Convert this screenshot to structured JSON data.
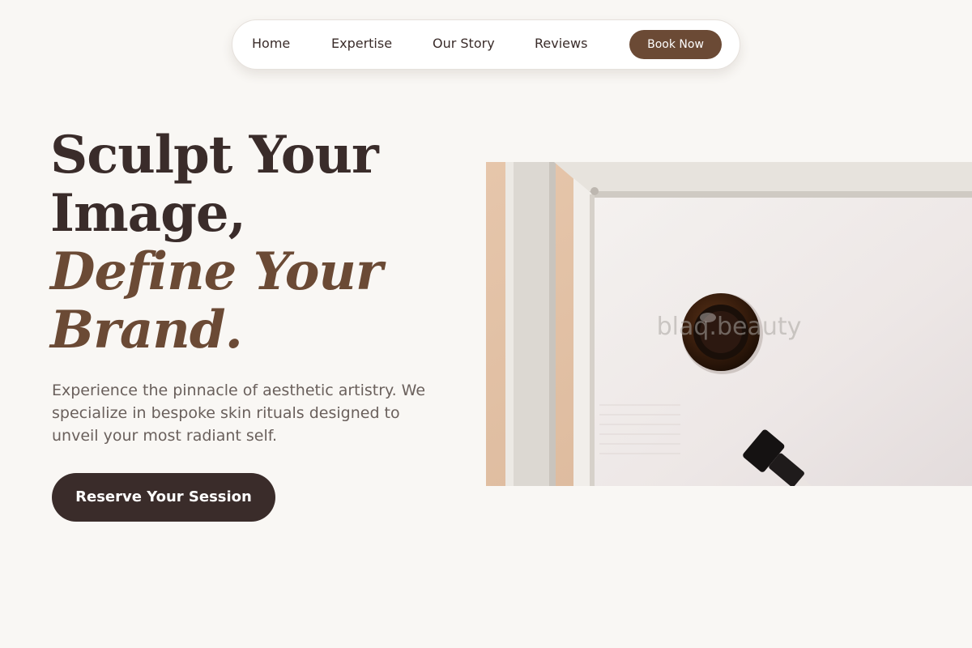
{
  "nav": {
    "links": [
      "Home",
      "Expertise",
      "Our Story",
      "Reviews"
    ],
    "book_label": "Book Now"
  },
  "hero": {
    "title_line1": "Sculpt Your",
    "title_line2": "Image,",
    "accent_line1": "Define Your",
    "accent_line2": "Brand.",
    "subtitle": "Experience the pinnacle of aesthetic artistry. We specialize in bespoke skin rituals designed to unveil your most radiant self.",
    "cta_label": "Reserve Your Session",
    "image_watermark": "blaq.beauty"
  },
  "colors": {
    "background": "#f9f7f4",
    "dark_brown": "#3a2c2a",
    "accent_brown": "#6b4a35",
    "body_text": "#6a605c"
  }
}
